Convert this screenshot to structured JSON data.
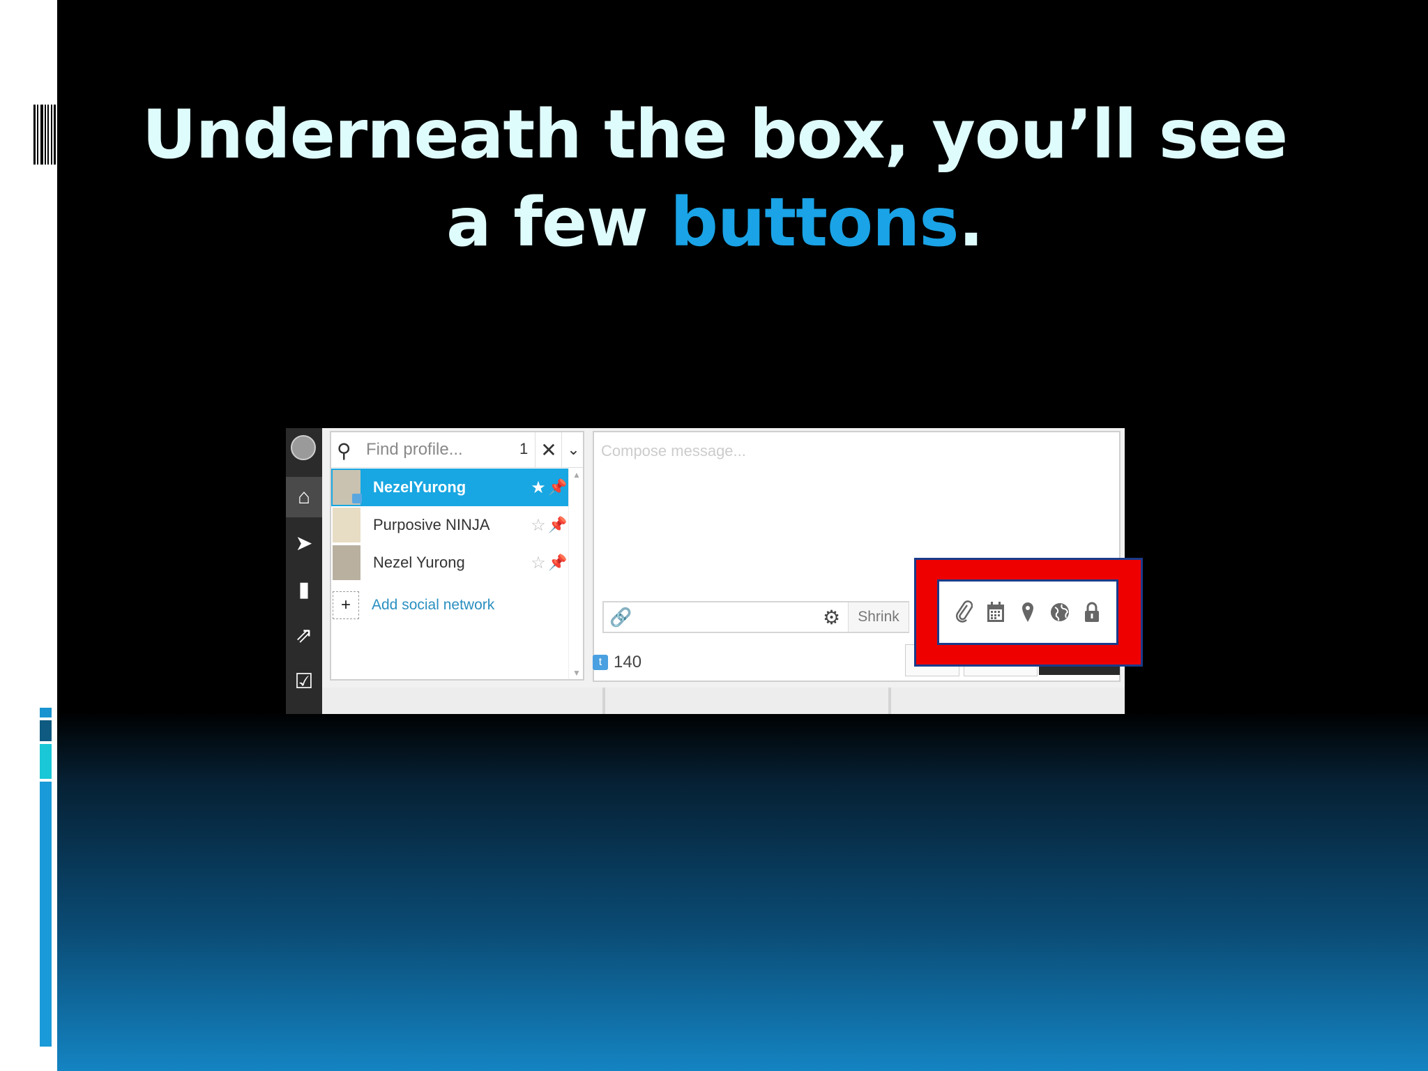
{
  "slide": {
    "title_line1": "Underneath the box, you’ll see",
    "title_line2_prefix": "a few ",
    "title_highlight": "buttons",
    "title_suffix": ".",
    "colors": {
      "title": "#dffcfc",
      "highlight": "#1aa3e6",
      "accent_box": "#ee0000",
      "accent_border": "#1a3b8a"
    }
  },
  "screenshot": {
    "rail": {
      "icons": [
        "owl-logo-icon",
        "home-icon",
        "send-icon",
        "analytics-icon",
        "assignments-icon",
        "tasks-icon"
      ]
    },
    "profile_picker": {
      "search_placeholder": "Find profile...",
      "selected_count": "1",
      "clear_glyph": "✕",
      "dropdown_glyph": "⌄",
      "profiles": [
        {
          "name": "NezelYurong",
          "selected": true
        },
        {
          "name": "Purposive NINJA",
          "selected": false
        },
        {
          "name": "Nezel Yurong",
          "selected": false
        }
      ],
      "add_label": "Add social network"
    },
    "composer": {
      "placeholder": "Compose message...",
      "shrink_label": "Shrink",
      "char_count": "140"
    },
    "toolbar_icons": [
      "attachment-icon",
      "calendar-icon",
      "location-icon",
      "globe-icon",
      "lock-icon"
    ]
  }
}
